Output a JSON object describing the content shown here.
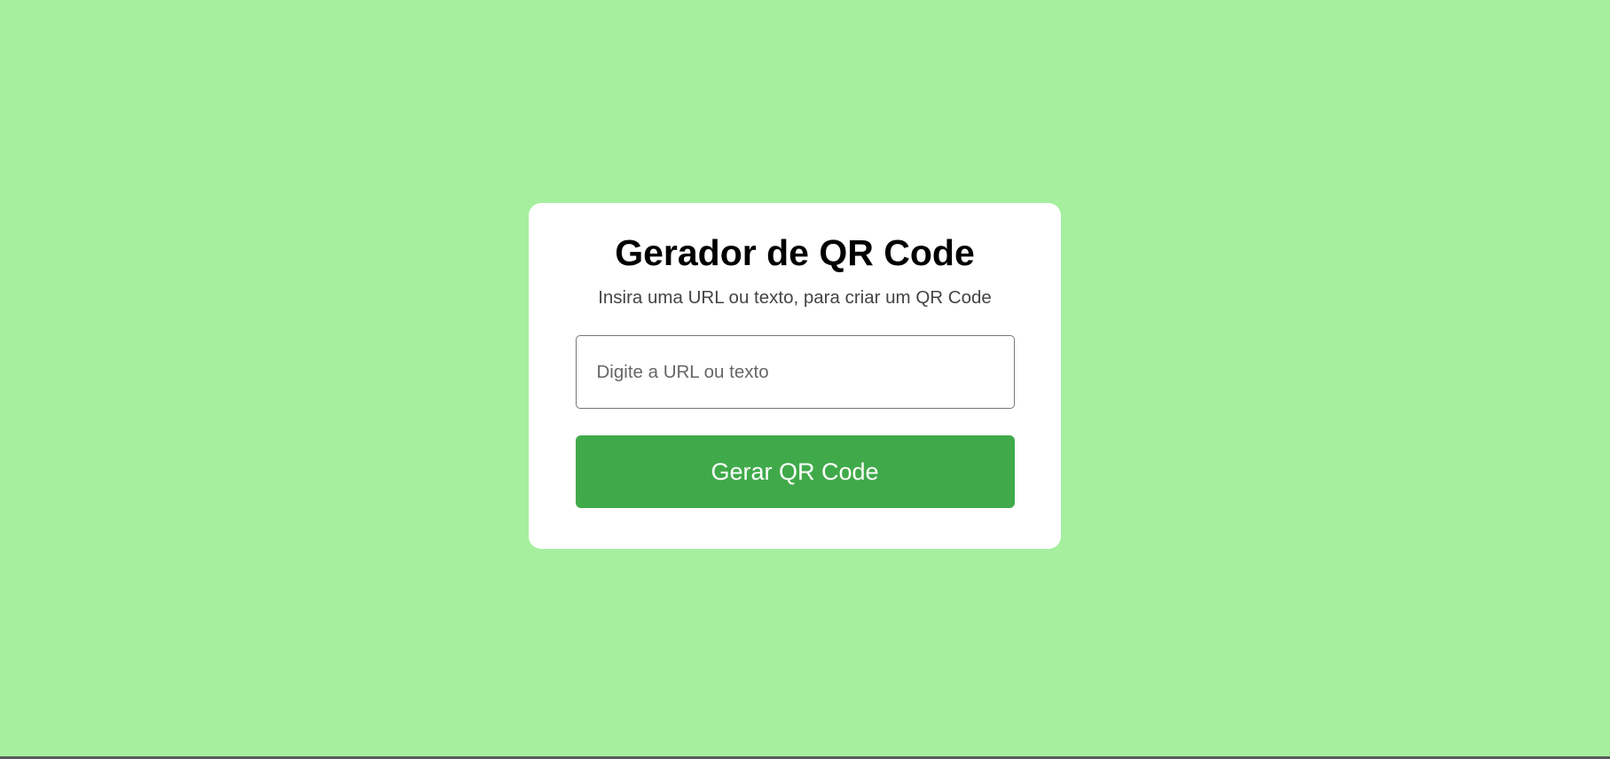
{
  "page": {
    "background_color": "#a6ef9f"
  },
  "card": {
    "title": "Gerador de QR Code",
    "subtitle": "Insira uma URL ou texto, para criar um QR Code",
    "input": {
      "value": "",
      "placeholder": "Digite a URL ou texto"
    },
    "button_label": "Gerar QR Code",
    "button_color": "#40aa4a"
  }
}
